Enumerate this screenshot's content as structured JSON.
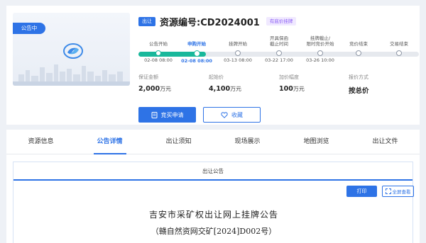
{
  "listing": {
    "cover_tag": "公告中",
    "badge": "出让",
    "title": "资源编号:CD2024001",
    "reserve_badge": "有底价挂牌"
  },
  "timeline": {
    "progress_pct": 24,
    "steps": [
      {
        "label": "公告开始",
        "date": "02-08 08:00",
        "state": "done"
      },
      {
        "label": "申购开始",
        "date": "02-08 08:00",
        "state": "current"
      },
      {
        "label": "挂牌开始",
        "date": "03-13 08:00",
        "state": "pending"
      },
      {
        "label": "开具保函\n截止时间",
        "date": "03-22 17:00",
        "state": "pending"
      },
      {
        "label": "挂牌截止/\n限时竞价开始",
        "date": "03-26 10:00",
        "state": "pending"
      },
      {
        "label": "竞价结束",
        "date": "",
        "state": "pending"
      },
      {
        "label": "交易结束",
        "date": "",
        "state": "pending"
      }
    ]
  },
  "info": {
    "deposit": {
      "label": "保证金额",
      "value": "2,000",
      "unit": "万元"
    },
    "start_price": {
      "label": "起始价",
      "value": "4,100",
      "unit": "万元"
    },
    "increment": {
      "label": "加价幅度",
      "value": "100",
      "unit": "万元"
    },
    "quote_method": {
      "label": "报价方式",
      "value": "按总价"
    }
  },
  "actions": {
    "bid_label": "竞买申请",
    "fav_label": "收藏"
  },
  "tabs": [
    {
      "label": "资源信息",
      "active": false
    },
    {
      "label": "公告详情",
      "active": true
    },
    {
      "label": "出让须知",
      "active": false
    },
    {
      "label": "现场展示",
      "active": false
    },
    {
      "label": "地图浏览",
      "active": false
    },
    {
      "label": "出让文件",
      "active": false
    }
  ],
  "notice": {
    "header": "出让公告",
    "print_label": "打印",
    "fullscreen_label": "全屏查看",
    "doc_title": "吉安市采矿权出让网上挂牌公告",
    "doc_subtitle": "（赣自然资网交矿[2024]D002号）"
  },
  "colors": {
    "primary": "#2e73e6",
    "progress": "#19b89b",
    "reserve_badge": "#8a5cf5"
  }
}
